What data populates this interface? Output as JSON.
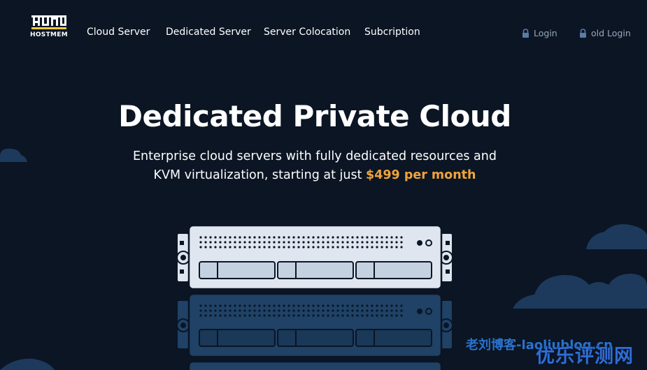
{
  "brand": {
    "name": "HOSTMEM"
  },
  "nav": {
    "links": [
      "Cloud Server",
      "Dedicated Server",
      "Server Colocation",
      "Subcription"
    ],
    "login": "Login",
    "old_login": "old Login"
  },
  "hero": {
    "title": "Dedicated Private Cloud",
    "subtitle_line1": "Enterprise cloud servers with fully dedicated resources and",
    "subtitle_line2": "KVM virtualization, starting at just ",
    "price": "$499 per month"
  },
  "watermark": {
    "site": "老刘博客-laoliublog.cn",
    "brand": "优乐评测网"
  },
  "colors": {
    "background": "#0b1524",
    "accent": "#f0a43a",
    "muted": "#9aa8ba",
    "cloud": "#1d3a5c",
    "server_light": "#dde5ef",
    "server_dark": "#1f4266"
  },
  "icons": [
    "logo-mark",
    "lock-icon",
    "server-rack-illustration",
    "cloud-decoration"
  ]
}
